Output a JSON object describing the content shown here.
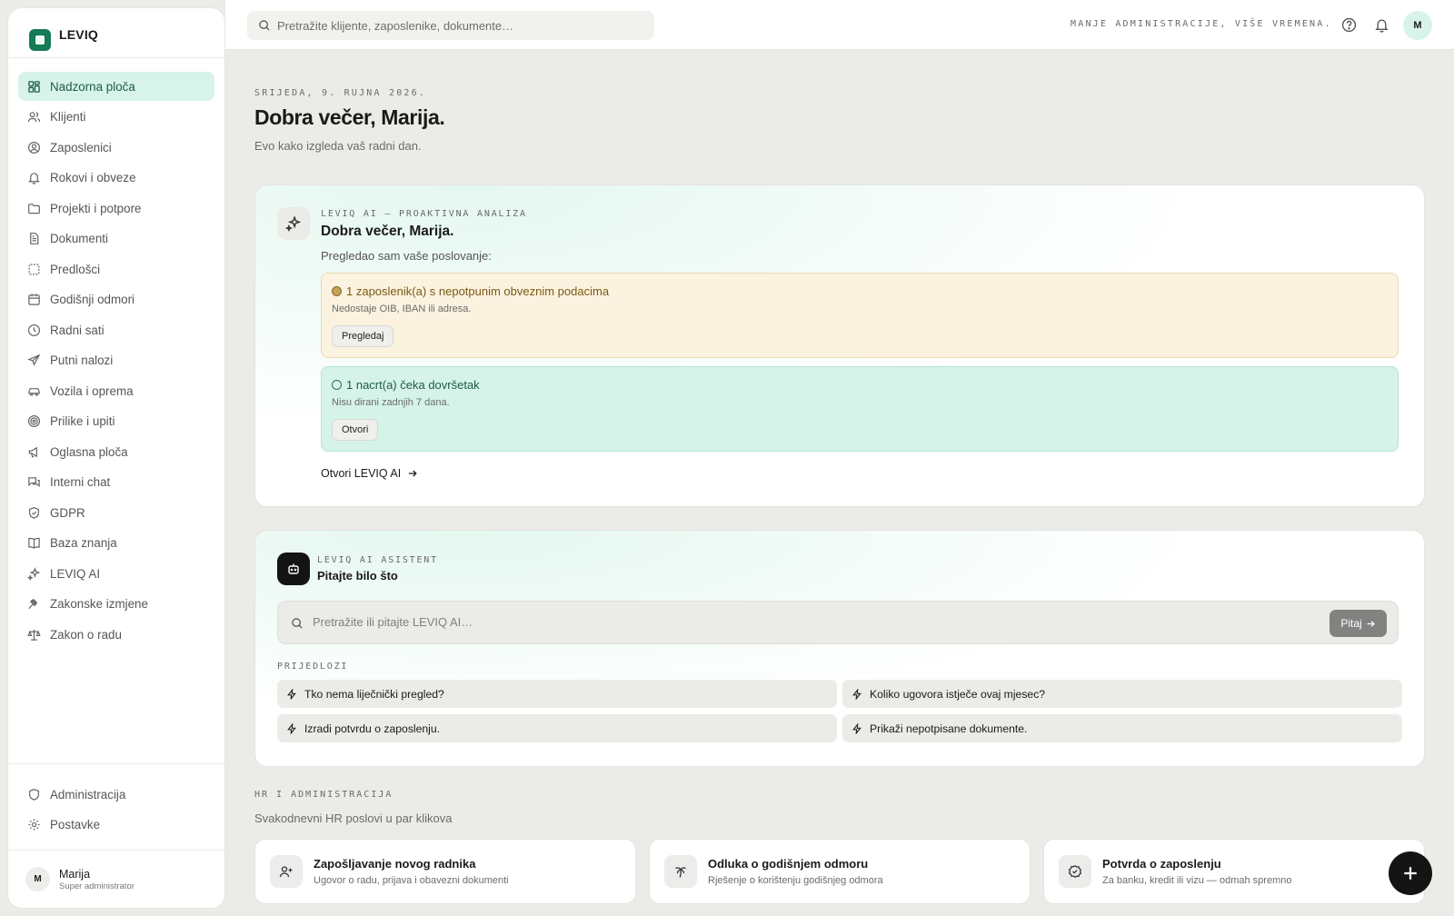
{
  "app": {
    "brand": "LEVIQ"
  },
  "sidebar": {
    "items": [
      {
        "label": "Nadzorna ploča",
        "icon": "dashboard-icon"
      },
      {
        "label": "Klijenti",
        "icon": "users-icon"
      },
      {
        "label": "Zaposlenici",
        "icon": "user-circle-icon"
      },
      {
        "label": "Rokovi i obveze",
        "icon": "bell-icon"
      },
      {
        "label": "Projekti i potpore",
        "icon": "folder-icon"
      },
      {
        "label": "Dokumenti",
        "icon": "document-icon"
      },
      {
        "label": "Predlošci",
        "icon": "template-icon"
      },
      {
        "label": "Godišnji odmori",
        "icon": "calendar-icon"
      },
      {
        "label": "Radni sati",
        "icon": "clock-icon"
      },
      {
        "label": "Putni nalozi",
        "icon": "plane-icon"
      },
      {
        "label": "Vozila i oprema",
        "icon": "car-icon"
      },
      {
        "label": "Prilike i upiti",
        "icon": "target-icon"
      },
      {
        "label": "Oglasna ploča",
        "icon": "megaphone-icon"
      },
      {
        "label": "Interni chat",
        "icon": "chat-icon"
      },
      {
        "label": "GDPR",
        "icon": "shield-check-icon"
      },
      {
        "label": "Baza znanja",
        "icon": "book-icon"
      },
      {
        "label": "LEVIQ AI",
        "icon": "sparkles-icon"
      },
      {
        "label": "Zakonske izmjene",
        "icon": "gavel-icon"
      },
      {
        "label": "Zakon o radu",
        "icon": "scale-icon"
      }
    ],
    "bottom": [
      {
        "label": "Administracija",
        "icon": "shield-icon"
      },
      {
        "label": "Postavke",
        "icon": "gear-icon"
      }
    ],
    "user": {
      "initial": "M",
      "name": "Marija",
      "role": "Super administrator"
    }
  },
  "topbar": {
    "search_placeholder": "Pretražite klijente, zaposlenike, dokumente…",
    "tagline": "MANJE ADMINISTRACIJE, VIŠE VREMENA.",
    "avatar_initial": "M"
  },
  "header": {
    "date": "SRIJEDA, 9. RUJNA 2026.",
    "greeting": "Dobra večer, Marija.",
    "subtitle": "Evo kako izgleda vaš radni dan."
  },
  "analysis": {
    "eyebrow": "LEVIQ AI — PROAKTIVNA ANALIZA",
    "title": "Dobra večer, Marija.",
    "intro": "Pregledao sam vaše poslovanje:",
    "alerts": [
      {
        "title": "1 zaposlenik(a) s nepotpunim obveznim podacima",
        "detail": "Nedostaje OIB, IBAN ili adresa.",
        "action": "Pregledaj",
        "color": "#7a5a12"
      },
      {
        "title": "1 nacrt(a) čeka dovršetak",
        "detail": "Nisu dirani zadnjih 7 dana.",
        "action": "Otvori",
        "color": "#1d5c45"
      }
    ],
    "link": "Otvori LEVIQ AI"
  },
  "assistant": {
    "eyebrow": "LEVIQ AI ASISTENT",
    "title": "Pitajte bilo što",
    "placeholder": "Pretražite ili pitajte LEVIQ AI…",
    "ask_button": "Pitaj",
    "suggestions_label": "PRIJEDLOZI",
    "suggestions": [
      "Tko nema liječnički pregled?",
      "Koliko ugovora istječe ovaj mjesec?",
      "Izradi potvrdu o zaposlenju.",
      "Prikaži nepotpisane dokumente."
    ]
  },
  "hr": {
    "eyebrow": "HR I ADMINISTRACIJA",
    "subtitle": "Svakodnevni HR poslovi u par klikova",
    "cards": [
      {
        "title": "Zapošljavanje novog radnika",
        "sub": "Ugovor o radu, prijava i obavezni dokumenti",
        "icon": "user-plus-icon"
      },
      {
        "title": "Odluka o godišnjem odmoru",
        "sub": "Rješenje o korištenju godišnjeg odmora",
        "icon": "palm-tree-icon"
      },
      {
        "title": "Potvrda o zaposlenju",
        "sub": "Za banku, kredit ili vizu — odmah spremno",
        "icon": "check-circle-icon"
      }
    ]
  },
  "colors": {
    "accent": "#157a55",
    "active_bg": "#d7f3ea",
    "warn_bg": "#fbf2e0",
    "info_bg": "#d6f3ea"
  }
}
